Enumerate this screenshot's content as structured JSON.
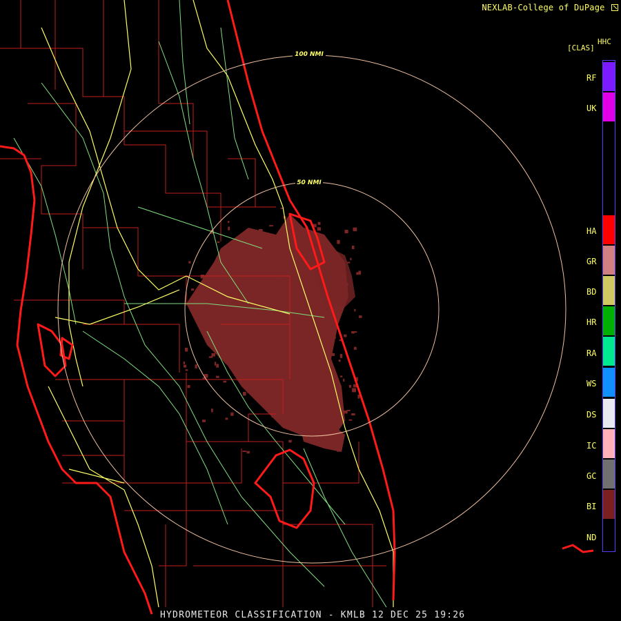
{
  "header": {
    "credit": "NEXLAB-College of DuPage",
    "credit_icon": "resize-arrow-icon",
    "product_code": "HHC",
    "product_sub": "[CLAS]"
  },
  "rings": {
    "outer_label": "100 NMI",
    "inner_label": "50 NMI"
  },
  "legend": [
    {
      "code": "RF",
      "color": "#7a1cff"
    },
    {
      "code": "UK",
      "color": "#e000e8"
    },
    {
      "code": "HA",
      "color": "#ff0000"
    },
    {
      "code": "GR",
      "color": "#d08080"
    },
    {
      "code": "BD",
      "color": "#d0c860"
    },
    {
      "code": "HR",
      "color": "#00b000"
    },
    {
      "code": "RA",
      "color": "#00e890"
    },
    {
      "code": "WS",
      "color": "#1090ff"
    },
    {
      "code": "DS",
      "color": "#e8e8f0"
    },
    {
      "code": "IC",
      "color": "#ffb0b8"
    },
    {
      "code": "GC",
      "color": "#707070"
    },
    {
      "code": "BI",
      "color": "#7a2020"
    },
    {
      "code": "ND",
      "color": "#000000"
    }
  ],
  "map_colors": {
    "county_lines": "#c41e1e",
    "coastline": "#ff1a1a",
    "highways": "#ffff66",
    "roads": "#80e080",
    "range_rings": "#f0c0a0",
    "echo": "#7a2626"
  },
  "footer": {
    "product": "HYDROMETEOR CLASSIFICATION",
    "separator": "-",
    "station": "KMLB",
    "datetime": "12 DEC 25 19:26"
  }
}
